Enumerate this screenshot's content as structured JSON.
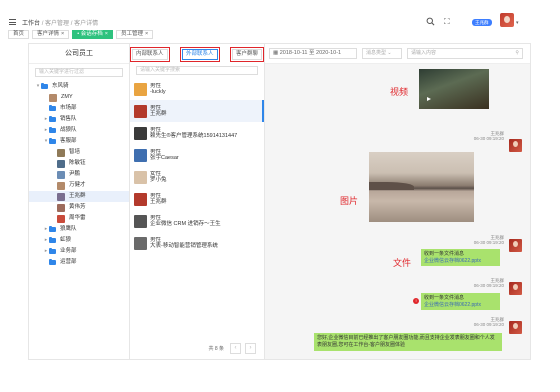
{
  "header": {
    "breadcrumb": [
      "工作台",
      "客户管理",
      "客户详情"
    ],
    "breadcrumb_sep": "/",
    "tabs": [
      {
        "label": "首页",
        "closable": false,
        "active": false
      },
      {
        "label": "客户详情",
        "closable": true,
        "active": false
      },
      {
        "label": "• 会话存档",
        "closable": true,
        "active": true
      },
      {
        "label": "员工管理",
        "closable": true,
        "active": false
      }
    ],
    "badge": "王兆群",
    "accent": "#2ec27e"
  },
  "org": {
    "title": "公司员工",
    "search_placeholder": "输入关键字进行过滤",
    "tree": [
      {
        "label": "东风骑",
        "type": "folder",
        "level": 0,
        "arrow": "▾"
      },
      {
        "label": "ZMY",
        "type": "person",
        "level": 1
      },
      {
        "label": "市场部",
        "type": "folder",
        "level": 1,
        "arrow": ""
      },
      {
        "label": "销售队",
        "type": "folder",
        "level": 1,
        "arrow": "▸"
      },
      {
        "label": "战狼队",
        "type": "folder",
        "level": 1,
        "arrow": "▸"
      },
      {
        "label": "客服部",
        "type": "folder",
        "level": 1,
        "arrow": "▾"
      },
      {
        "label": "智培",
        "type": "person",
        "level": 2
      },
      {
        "label": "陈敏钰",
        "type": "person",
        "level": 2
      },
      {
        "label": "尹鹏",
        "type": "person",
        "level": 2
      },
      {
        "label": "万健才",
        "type": "person",
        "level": 2
      },
      {
        "label": "王兆群",
        "type": "person",
        "level": 2,
        "selected": true
      },
      {
        "label": "黄伟芳",
        "type": "person",
        "level": 2
      },
      {
        "label": "周华雷",
        "type": "person",
        "level": 2
      },
      {
        "label": "狼鹰队",
        "type": "folder",
        "level": 1,
        "arrow": "▸"
      },
      {
        "label": "虹狼",
        "type": "folder",
        "level": 1,
        "arrow": "▸"
      },
      {
        "label": "业务部",
        "type": "folder",
        "level": 1,
        "arrow": "▸"
      },
      {
        "label": "运营部",
        "type": "folder",
        "level": 1,
        "arrow": ""
      }
    ]
  },
  "contacts": {
    "buttons": [
      "内部联系人",
      "外部联系人",
      "客户群聊"
    ],
    "search_placeholder": "请输入关键字搜索",
    "items": [
      {
        "line1": "男性",
        "line2": "-luckly"
      },
      {
        "line1": "男性",
        "line2": "王兆群",
        "selected": true
      },
      {
        "line1": "男性",
        "line2": "赖先生®客户管理系统15914131447"
      },
      {
        "line1": "男性",
        "line2": "张宇Caesar"
      },
      {
        "line1": "女性",
        "line2": "罗小兔"
      },
      {
        "line1": "男性",
        "line2": "王兆群"
      },
      {
        "line1": "男性",
        "line2": "企业微信 CRM 进销存～王生"
      },
      {
        "line1": "男性",
        "line2": "大表-移动智能营销管理系统"
      }
    ],
    "total": "共 8 条",
    "prev": "‹",
    "next": "›"
  },
  "chat": {
    "date_range": "2018-10-11 至 2020-10-1",
    "type_placeholder": "消息类型",
    "keyword_placeholder": "请输入内容",
    "annotations": {
      "video": "视频",
      "image": "图片",
      "file": "文件"
    },
    "sender_name": "王兆群",
    "messages": [
      {
        "kind": "image",
        "time": "06-30 09:19:20"
      },
      {
        "kind": "file",
        "time": "06-30 09:19:20",
        "text": "收到一条文件消息",
        "link": "企业微信云存档0622.pptx"
      },
      {
        "kind": "file",
        "time": "06-30 09:19:20",
        "text": "收到一条文件消息",
        "link": "企业微信云存档0622.pptx",
        "error": true
      },
      {
        "kind": "text",
        "time": "06-30 09:19:20",
        "text": "您好,企业微信目前已经推出了客户朋友圈功能,而且支持企业发表朋友圈和个人发表朋友圈,您可在工作台-客户朋友圈体验"
      }
    ],
    "error_mark": "!",
    "bubble_color": "#a9e26d",
    "annotation_color": "#e0262b"
  }
}
